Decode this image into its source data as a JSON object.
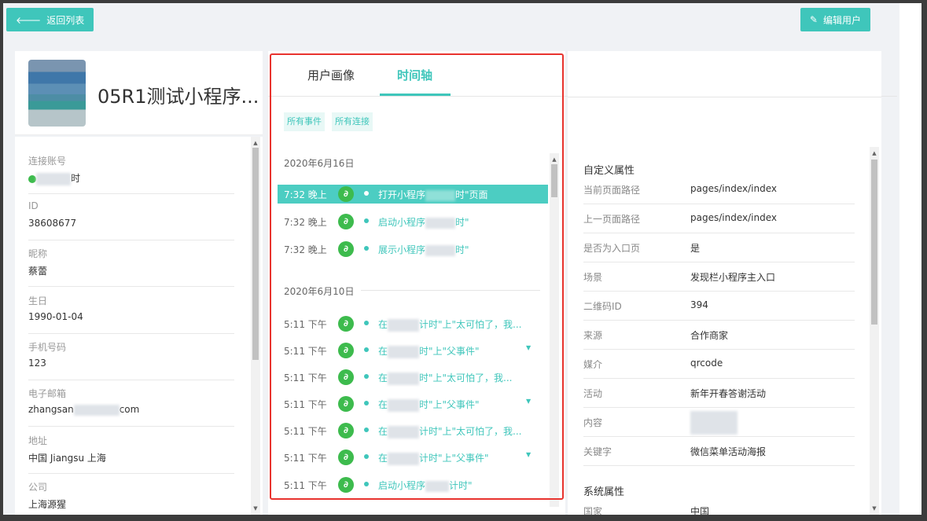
{
  "header": {
    "back_label": "返回列表",
    "back_icon": "arrow-left-icon",
    "edit_label": "编辑用户",
    "edit_icon": "pencil-icon"
  },
  "user": {
    "name": "05R1测试小程序..."
  },
  "profile_fields": [
    {
      "label": "连接账号",
      "value": "时"
    },
    {
      "label": "ID",
      "value": "38608677"
    },
    {
      "label": "昵称",
      "value": "蔡蕾"
    },
    {
      "label": "生日",
      "value": "1990-01-04"
    },
    {
      "label": "手机号码",
      "value": "123"
    },
    {
      "label": "电子邮箱",
      "value_prefix": "zhangsan",
      "value_suffix": "com"
    },
    {
      "label": "地址",
      "value": "中国 Jiangsu 上海"
    },
    {
      "label": "公司",
      "value": "上海源猩"
    }
  ],
  "tabs": [
    {
      "label": "用户画像",
      "active": false
    },
    {
      "label": "时间轴",
      "active": true
    }
  ],
  "filters": [
    "所有事件",
    "所有连接"
  ],
  "timeline": [
    {
      "date": "2020年6月16日",
      "events": [
        {
          "time": "7:32 晚上",
          "text": "打开小程序",
          "text_suffix": "时\"页面",
          "highlight": true
        },
        {
          "time": "7:32 晚上",
          "text": "启动小程序",
          "text_suffix": "时\""
        },
        {
          "time": "7:32 晚上",
          "text": "展示小程序",
          "text_suffix": "时\""
        }
      ]
    },
    {
      "date": "2020年6月10日",
      "events": [
        {
          "time": "5:11 下午",
          "text": "在",
          "text_suffix": "计时\"上\"太可怕了，我..."
        },
        {
          "time": "5:11 下午",
          "text": "在",
          "text_suffix": "时\"上\"父事件\"",
          "expand": true
        },
        {
          "time": "5:11 下午",
          "text": "在",
          "text_suffix": "时\"上\"太可怕了，我..."
        },
        {
          "time": "5:11 下午",
          "text": "在",
          "text_suffix": "时\"上\"父事件\"",
          "expand": true
        },
        {
          "time": "5:11 下午",
          "text": "在",
          "text_suffix": "计时\"上\"太可怕了，我..."
        },
        {
          "time": "5:11 下午",
          "text": "在",
          "text_suffix": "计时\"上\"父事件\"",
          "expand": true
        },
        {
          "time": "5:11 下午",
          "text": "启动小程序",
          "text_suffix": "计时\""
        }
      ]
    }
  ],
  "custom_props": {
    "title": "自定义属性",
    "items": [
      {
        "key": "当前页面路径",
        "value": "pages/index/index"
      },
      {
        "key": "上一页面路径",
        "value": "pages/index/index"
      },
      {
        "key": "是否为入口页",
        "value": "是"
      },
      {
        "key": "场景",
        "value": "发现栏小程序主入口"
      },
      {
        "key": "二维码ID",
        "value": "394"
      },
      {
        "key": "来源",
        "value": "合作商家"
      },
      {
        "key": "媒介",
        "value": "qrcode"
      },
      {
        "key": "活动",
        "value": "新年开春答谢活动"
      },
      {
        "key": "内容",
        "value": ""
      },
      {
        "key": "关键字",
        "value": "微信菜单活动海报"
      }
    ]
  },
  "system_props": {
    "title": "系统属性",
    "items": [
      {
        "key": "国家",
        "value": "中国"
      }
    ]
  },
  "colors": {
    "accent": "#3fc6bb",
    "highlight": "#e8332e",
    "miniprogram": "#3dbb4d"
  }
}
